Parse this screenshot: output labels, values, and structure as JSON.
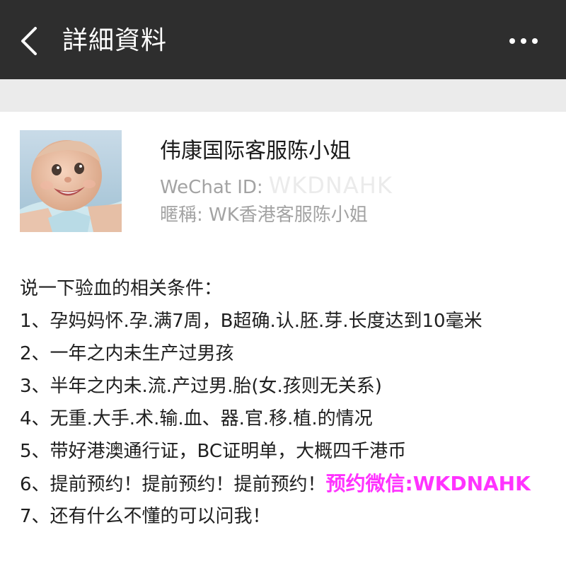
{
  "header": {
    "title": "詳細資料",
    "back_icon": "chevron-left-icon",
    "more_icon": "more-dots-icon"
  },
  "profile": {
    "name": "伟康国际客服陈小姐",
    "wechat_id_label": "WeChat ID:",
    "wechat_id_value": "WKDNAHK",
    "nickname": "暱稱: WK香港客服陈小姐",
    "avatar_icon": "baby-avatar"
  },
  "message": {
    "intro": "说一下验血的相关条件：",
    "items": [
      "1、孕妈妈怀.孕.满7周，B超确.认.胚.芽.长度达到10毫米",
      "2、一年之内未生产过男孩",
      "3、半年之内未.流.产过男.胎(女.孩则无关系)",
      "4、无重.大手.术.输.血、器.官.移.植.的情况",
      "5、带好港澳通行证，BC证明单，大概四千港币",
      "6、提前预约！提前预约！提前预约！",
      "7、还有什么不懂的可以问我！"
    ],
    "highlight": "预约微信:WKDNAHK"
  },
  "colors": {
    "header_bg": "#2e2e2e",
    "band_bg": "#ebebeb",
    "secondary_text": "#a3a3a3",
    "highlight": "#ff33ff"
  }
}
